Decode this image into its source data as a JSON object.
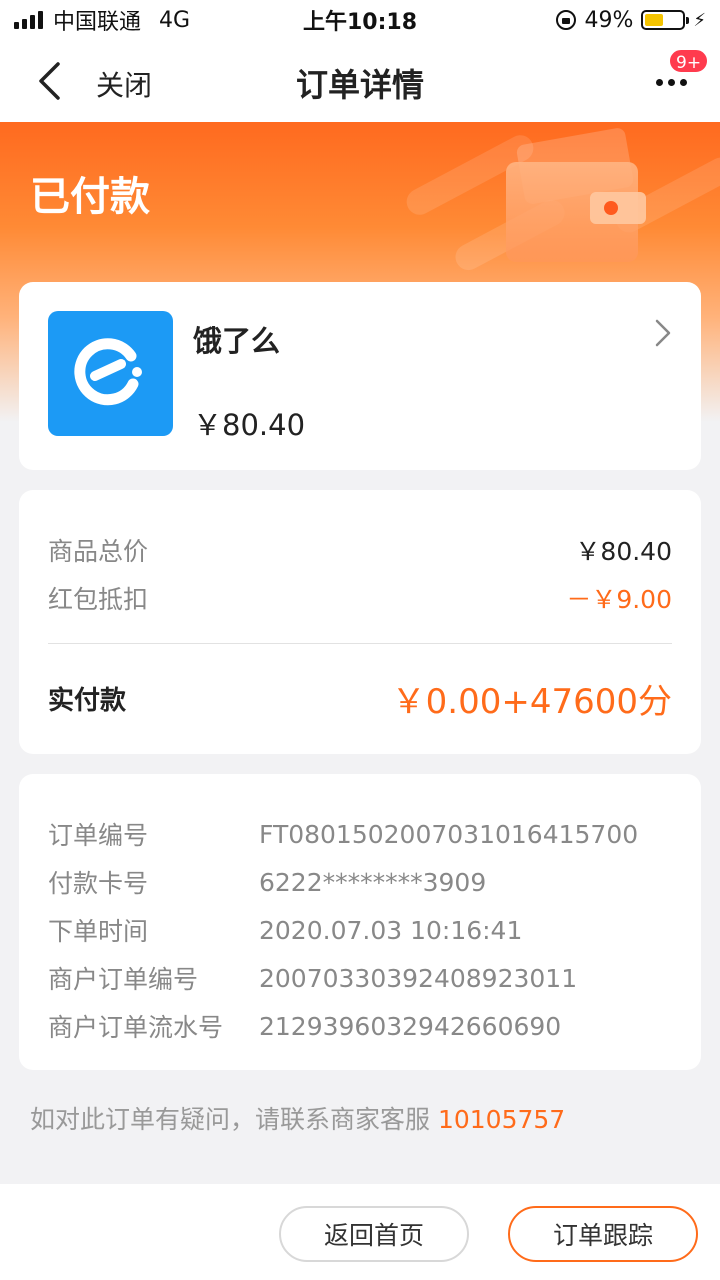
{
  "status_bar": {
    "carrier": "中国联通",
    "network": "4G",
    "time": "上午10:18",
    "battery_percent": "49%",
    "battery_level": 0.49,
    "battery_color": "#f5c400"
  },
  "nav": {
    "close_label": "关闭",
    "title": "订单详情",
    "badge": "9+",
    "back_icon": "chevron-left-icon",
    "more_icon": "more-dots-icon"
  },
  "header": {
    "status": "已付款",
    "gradient_color": "#ff6a1f"
  },
  "merchant": {
    "name": "饿了么",
    "amount": "￥80.40",
    "icon": "eleme-app-icon",
    "icon_color": "#1c9af5"
  },
  "price": {
    "subtotal_label": "商品总价",
    "subtotal_value": "￥80.40",
    "discount_label": "红包抵扣",
    "discount_value": "－￥9.00",
    "paid_label": "实付款",
    "paid_value": "￥0.00+47600分",
    "accent_color": "#ff6b1a"
  },
  "info": {
    "rows": [
      {
        "label": "订单编号",
        "value": "FT0801502007031016415700"
      },
      {
        "label": "付款卡号",
        "value": "6222********3909"
      },
      {
        "label": "下单时间",
        "value": "2020.07.03 10:16:41"
      },
      {
        "label": "商户订单编号",
        "value": "20070330392408923011"
      },
      {
        "label": "商户订单流水号",
        "value": "2129396032942660690"
      }
    ]
  },
  "contact": {
    "text": "如对此订单有疑问，请联系商家客服",
    "phone": "10105757"
  },
  "bottom": {
    "home_button": "返回首页",
    "track_button": "订单跟踪"
  }
}
